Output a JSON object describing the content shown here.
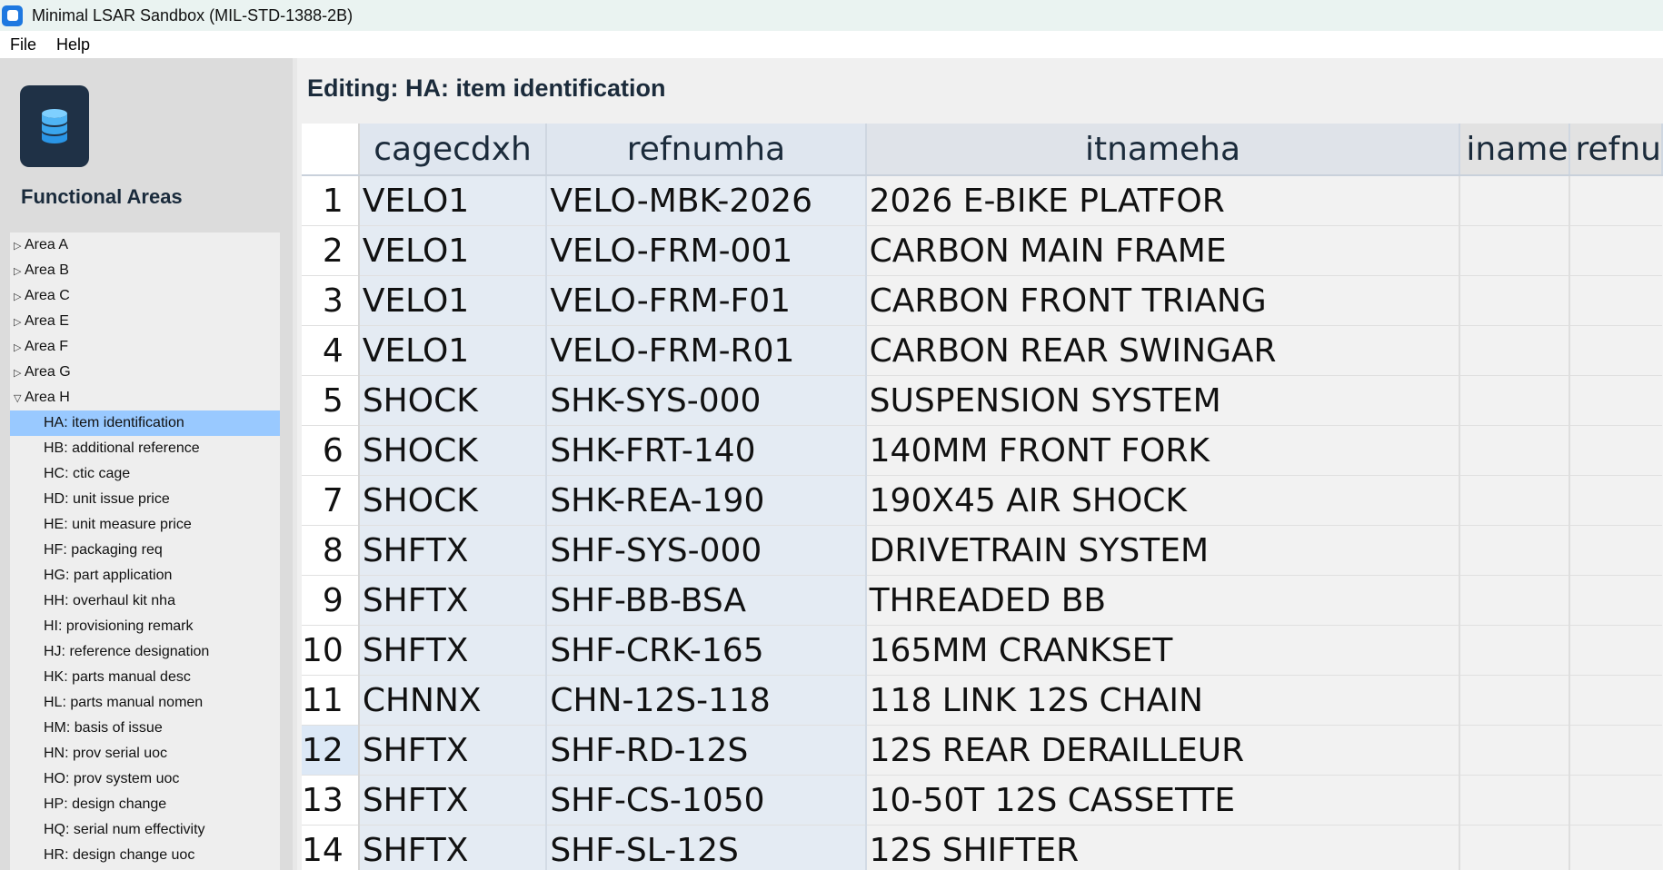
{
  "window": {
    "title": "Minimal LSAR Sandbox (MIL-STD-1388-2B)"
  },
  "menu": [
    "File",
    "Help"
  ],
  "sidebar": {
    "heading": "Functional Areas",
    "icon": "database-icon",
    "areas": [
      "Area A",
      "Area B",
      "Area C",
      "Area E",
      "Area F",
      "Area G",
      "Area H"
    ],
    "expanded_area": "Area H",
    "selected_item": "HA: item identification",
    "children": [
      "HA: item identification",
      "HB: additional reference",
      "HC: ctic cage",
      "HD: unit issue price",
      "HE: unit measure price",
      "HF: packaging req",
      "HG: part application",
      "HH: overhaul kit nha",
      "HI: provisioning remark",
      "HJ: reference designation",
      "HK: parts manual desc",
      "HL: parts manual nomen",
      "HM: basis of issue",
      "HN: prov serial uoc",
      "HO: prov system uoc",
      "HP: design change",
      "HQ: serial num effectivity",
      "HR: design change uoc"
    ]
  },
  "main": {
    "editing_label": "Editing: HA: item identification",
    "columns": [
      "cagecdxh",
      "refnumha",
      "itnameha",
      "iname",
      "refnu"
    ],
    "selected_row": "12",
    "rows": [
      {
        "n": "1",
        "cagecdxh": "VELO1",
        "refnumha": "VELO-MBK-2026",
        "itnameha": "2026 E-BIKE PLATFOR"
      },
      {
        "n": "2",
        "cagecdxh": "VELO1",
        "refnumha": "VELO-FRM-001",
        "itnameha": "CARBON MAIN FRAME"
      },
      {
        "n": "3",
        "cagecdxh": "VELO1",
        "refnumha": "VELO-FRM-F01",
        "itnameha": "CARBON FRONT TRIANG"
      },
      {
        "n": "4",
        "cagecdxh": "VELO1",
        "refnumha": "VELO-FRM-R01",
        "itnameha": "CARBON REAR SWINGAR"
      },
      {
        "n": "5",
        "cagecdxh": "SHOCK",
        "refnumha": "SHK-SYS-000",
        "itnameha": "SUSPENSION SYSTEM"
      },
      {
        "n": "6",
        "cagecdxh": "SHOCK",
        "refnumha": "SHK-FRT-140",
        "itnameha": "140MM FRONT FORK"
      },
      {
        "n": "7",
        "cagecdxh": "SHOCK",
        "refnumha": "SHK-REA-190",
        "itnameha": "190X45 AIR SHOCK"
      },
      {
        "n": "8",
        "cagecdxh": "SHFTX",
        "refnumha": "SHF-SYS-000",
        "itnameha": "DRIVETRAIN SYSTEM"
      },
      {
        "n": "9",
        "cagecdxh": "SHFTX",
        "refnumha": "SHF-BB-BSA",
        "itnameha": "THREADED BB"
      },
      {
        "n": "10",
        "cagecdxh": "SHFTX",
        "refnumha": "SHF-CRK-165",
        "itnameha": "165MM CRANKSET"
      },
      {
        "n": "11",
        "cagecdxh": "CHNNX",
        "refnumha": "CHN-12S-118",
        "itnameha": "118 LINK 12S CHAIN"
      },
      {
        "n": "12",
        "cagecdxh": "SHFTX",
        "refnumha": "SHF-RD-12S",
        "itnameha": "12S REAR DERAILLEUR"
      },
      {
        "n": "13",
        "cagecdxh": "SHFTX",
        "refnumha": "SHF-CS-1050",
        "itnameha": "10-50T 12S CASSETTE"
      },
      {
        "n": "14",
        "cagecdxh": "SHFTX",
        "refnumha": "SHF-SL-12S",
        "itnameha": "12S SHIFTER"
      }
    ]
  }
}
